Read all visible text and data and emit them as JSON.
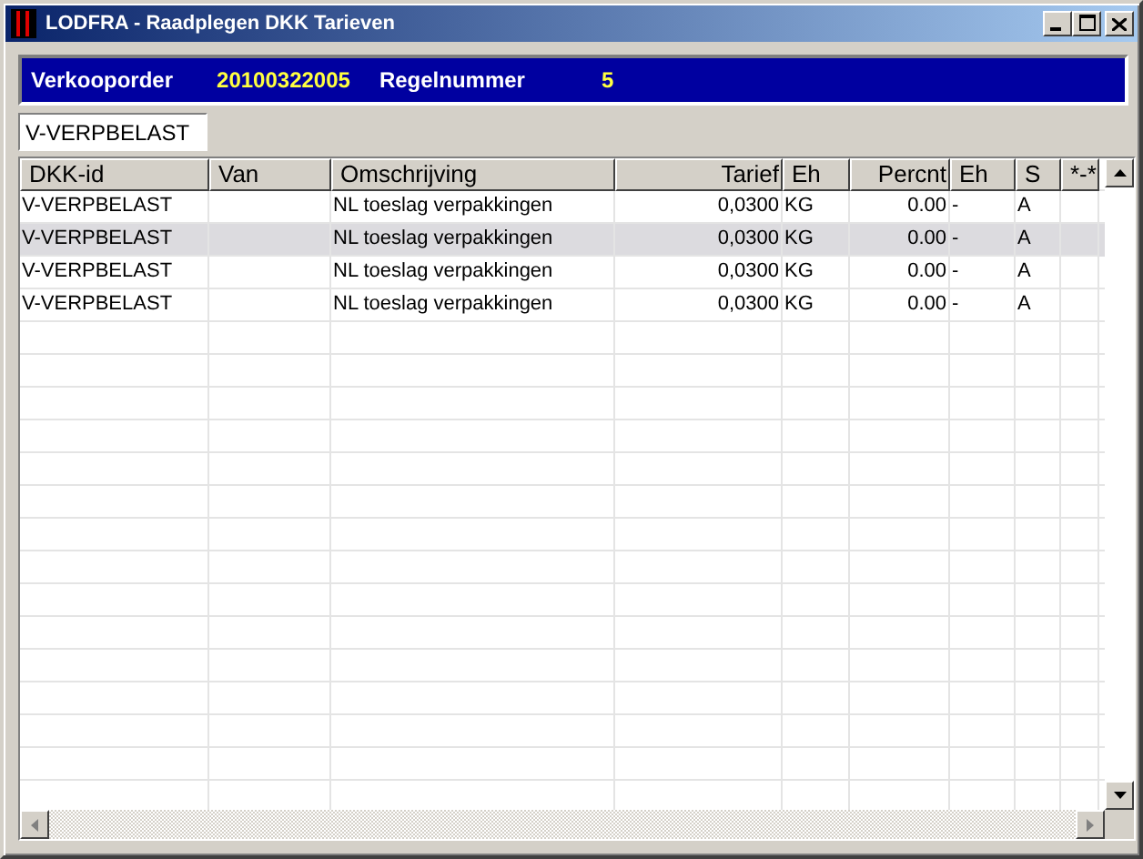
{
  "window": {
    "title": "LODFRA - Raadplegen DKK Tarieven"
  },
  "header": {
    "fields": [
      {
        "label": "Verkooporder",
        "value": "20100322005"
      },
      {
        "label": "Regelnummer",
        "value": "5"
      }
    ]
  },
  "search": {
    "value": "V-VERPBELAST"
  },
  "table": {
    "columns": [
      {
        "label": "DKK-id"
      },
      {
        "label": "Van"
      },
      {
        "label": "Omschrijving"
      },
      {
        "label": "Tarief"
      },
      {
        "label": "Eh"
      },
      {
        "label": "Percnt"
      },
      {
        "label": "Eh"
      },
      {
        "label": "S"
      },
      {
        "label": "*-*"
      }
    ],
    "rows": [
      {
        "selected": false,
        "cells": [
          "V-VERPBELAST",
          "",
          "NL toeslag verpakkingen",
          "0,0300",
          "KG",
          "0.00",
          "-",
          "A",
          ""
        ]
      },
      {
        "selected": true,
        "cells": [
          "V-VERPBELAST",
          "",
          "NL toeslag verpakkingen",
          "0,0300",
          "KG",
          "0.00",
          "-",
          "A",
          ""
        ]
      },
      {
        "selected": false,
        "cells": [
          "V-VERPBELAST",
          "",
          "NL toeslag verpakkingen",
          "0,0300",
          "KG",
          "0.00",
          "-",
          "A",
          ""
        ]
      },
      {
        "selected": false,
        "cells": [
          "V-VERPBELAST",
          "",
          "NL toeslag verpakkingen",
          "0,0300",
          "KG",
          "0.00",
          "-",
          "A",
          ""
        ]
      }
    ]
  }
}
